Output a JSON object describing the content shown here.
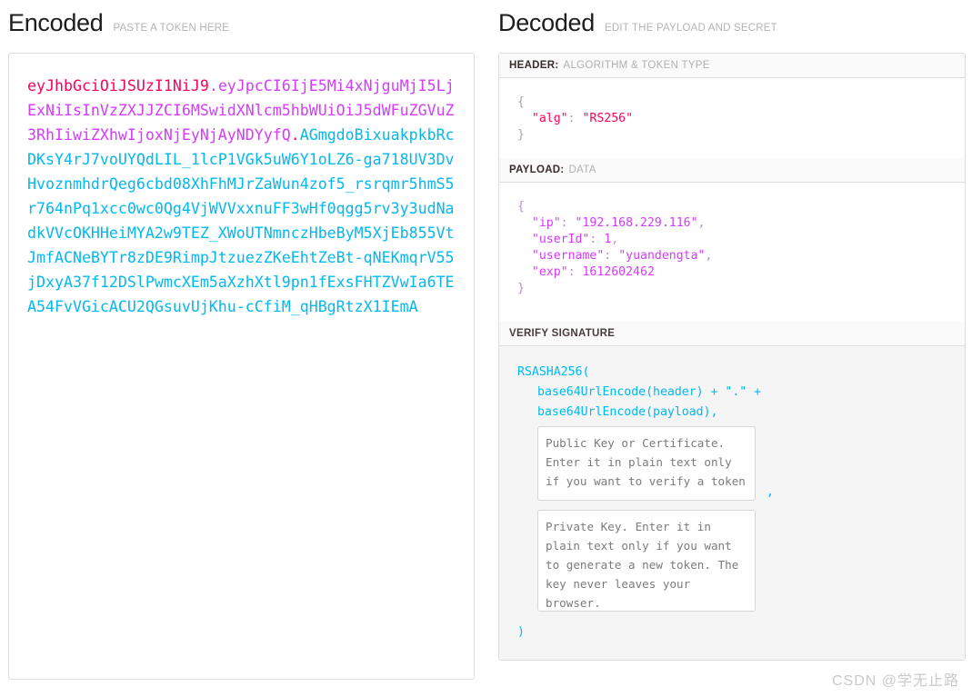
{
  "encoded": {
    "title": "Encoded",
    "subtitle": "PASTE A TOKEN HERE",
    "token": {
      "header": "eyJhbGciOiJSUzI1NiJ9",
      "separator1": ".",
      "payload": "eyJpcCI6IjE5Mi4xNjguMjI5LjExNiIsInVzZXJJZCI6MSwidXNlcm5hbWUiOiJ5dWFuZGVuZ3RhIiwiZXhwIjoxNjEyNjAyNDYyfQ",
      "separator2": ".",
      "signature": "AGmgdoBixuakpkbRcDKsY4rJ7voUYQdLIL_1lcP1VGk5uW6Y1oLZ6-ga718UV3DvHvoznmhdrQeg6cbd08XhFhMJrZaWun4zof5_rsrqmr5hmS5r764nPq1xcc0wc0Qg4VjWVVxxnuFF3wHf0qgg5rv3y3udNadkVVcOKHHeiMYA2w9TEZ_XWoUTNmnczHbeByM5XjEb855VtJmfACNeBYTr8zDE9RimpJtzuezZKeEhtZeBt-qNEKmqrV55jDxyA37f12DSlPwmcXEm5aXzhXtl9pn1fExsFHTZVwIa6TEA54FvVGicACU2QGsuvUjKhu-cCfiM_qHBgRtzX1IEmA"
    },
    "colors": {
      "header_color": "#fb015b",
      "payload_color": "#d63aff",
      "signature_color": "#00b9f1"
    }
  },
  "decoded": {
    "title": "Decoded",
    "subtitle": "EDIT THE PAYLOAD AND SECRET",
    "sections": {
      "header": {
        "label": "HEADER:",
        "label_suffix": "ALGORITHM & TOKEN TYPE",
        "json": {
          "open": "{",
          "key": "\"alg\"",
          "colon": ": ",
          "value": "\"RS256\"",
          "close": "}"
        }
      },
      "payload": {
        "label": "PAYLOAD:",
        "label_suffix": "DATA",
        "json": {
          "open": "{",
          "close": "}",
          "entries": [
            {
              "key": "\"ip\"",
              "value": "\"192.168.229.116\"",
              "comma": ","
            },
            {
              "key": "\"userId\"",
              "value": "1",
              "comma": ","
            },
            {
              "key": "\"username\"",
              "value": "\"yuandengta\"",
              "comma": ","
            },
            {
              "key": "\"exp\"",
              "value": "1612602462",
              "comma": ""
            }
          ]
        }
      },
      "signature": {
        "label": "VERIFY SIGNATURE",
        "label_suffix": "",
        "line1": "RSASHA256(",
        "line2": "base64UrlEncode(header) + \".\" +",
        "line3": "base64UrlEncode(payload),",
        "comma_after_public_key": ",",
        "close": ")",
        "public_key_placeholder": "Public Key or Certificate. Enter it in plain text only if you want to verify a token",
        "private_key_placeholder": "Private Key. Enter it in plain text only if you want to generate a new token. The key never leaves your browser.",
        "public_key_value": "",
        "private_key_value": ""
      }
    }
  },
  "watermark": "CSDN @学无止路"
}
